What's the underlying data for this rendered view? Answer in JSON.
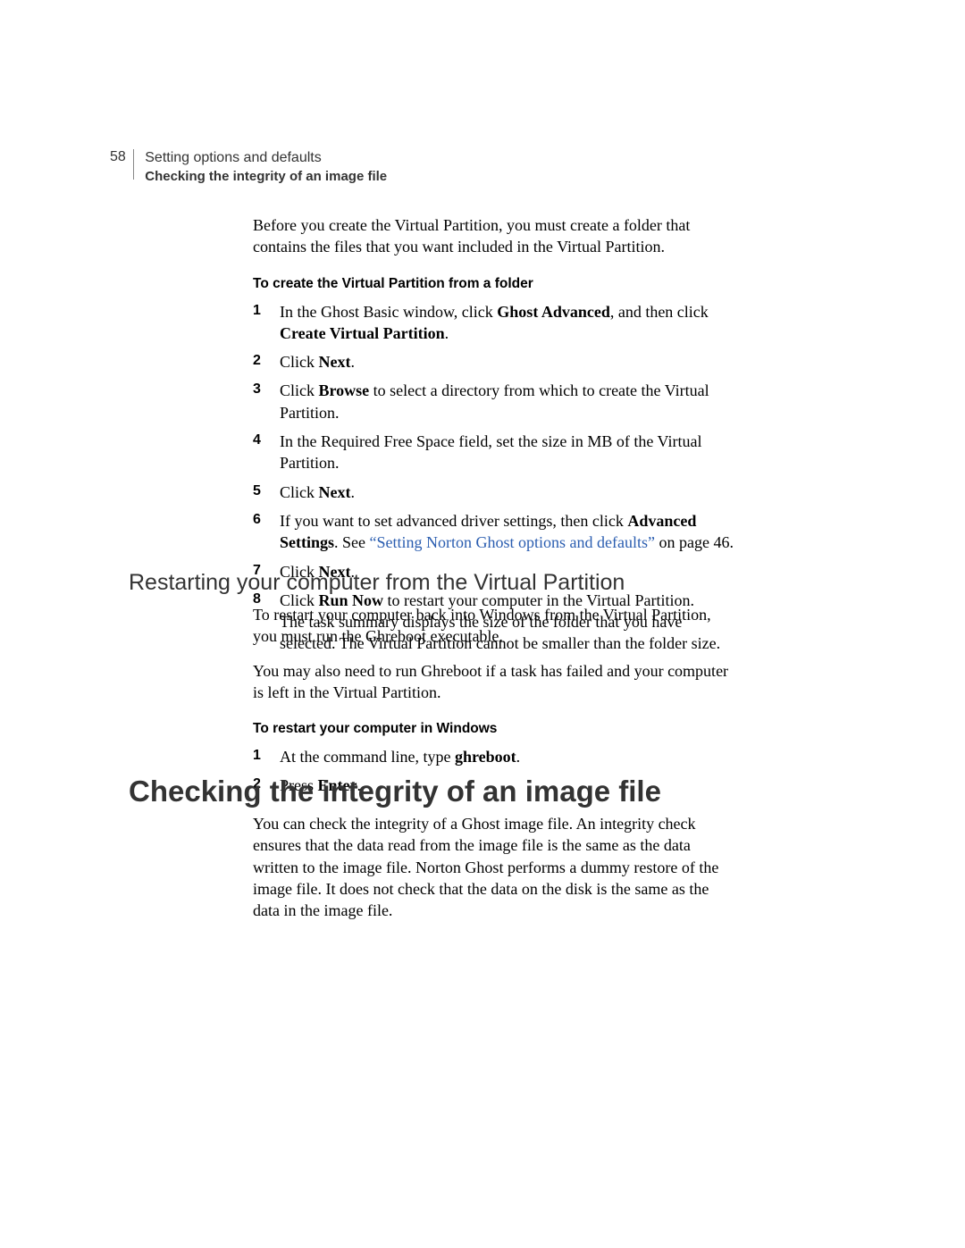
{
  "header": {
    "page_number": "58",
    "chapter": "Setting options and defaults",
    "section": "Checking the integrity of an image file"
  },
  "intro": {
    "p1_a": "Before you create the Virtual Partition, you must create a folder that contains the files that you want included in the Virtual Partition."
  },
  "proc1": {
    "title": "To create the Virtual Partition from a folder",
    "s1_a": "In the Ghost Basic window, click ",
    "s1_b": "Ghost Advanced",
    "s1_c": ", and then click ",
    "s1_d": "Create Virtual Partition",
    "s1_e": ".",
    "s2_a": "Click ",
    "s2_b": "Next",
    "s2_c": ".",
    "s3_a": "Click ",
    "s3_b": "Browse",
    "s3_c": " to select a directory from which to create the Virtual Partition.",
    "s4_a": "In the Required Free Space field, set the size in MB of the Virtual Partition.",
    "s5_a": "Click ",
    "s5_b": "Next",
    "s5_c": ".",
    "s6_a": "If you want to set advanced driver settings, then click ",
    "s6_b": "Advanced Settings",
    "s6_c": ". See ",
    "s6_link": "“Setting Norton Ghost options and defaults”",
    "s6_d": " on page 46.",
    "s7_a": "Click ",
    "s7_b": "Next",
    "s7_c": ".",
    "s8_a": "Click ",
    "s8_b": "Run Now",
    "s8_c": " to restart your computer in the Virtual Partition.",
    "s8_d": "The task summary displays the size of the folder that you have selected. The Virtual Partition cannot be smaller than the folder size."
  },
  "h2_restart": "Restarting your computer from the Virtual Partition",
  "restart": {
    "p1": "To restart your computer back into Windows from the Virtual Partition, you must run the Ghreboot executable.",
    "p2": "You may also need to run Ghreboot if a task has failed and your computer is left in the Virtual Partition."
  },
  "proc2": {
    "title": "To restart your computer in Windows",
    "s1_a": "At the command line, type ",
    "s1_b": "ghreboot",
    "s1_c": ".",
    "s2_a": "Press ",
    "s2_b": "Enter",
    "s2_c": "."
  },
  "h2_main": "Checking the integrity of an image file",
  "integrity": {
    "p1": "You can check the integrity of a Ghost image file. An integrity check ensures that the data read from the image file is the same as the data written to the image file. Norton Ghost performs a dummy restore of the image file. It does not check that the data on the disk is the same as the data in the image file."
  },
  "nums": {
    "n1": "1",
    "n2": "2",
    "n3": "3",
    "n4": "4",
    "n5": "5",
    "n6": "6",
    "n7": "7",
    "n8": "8"
  }
}
